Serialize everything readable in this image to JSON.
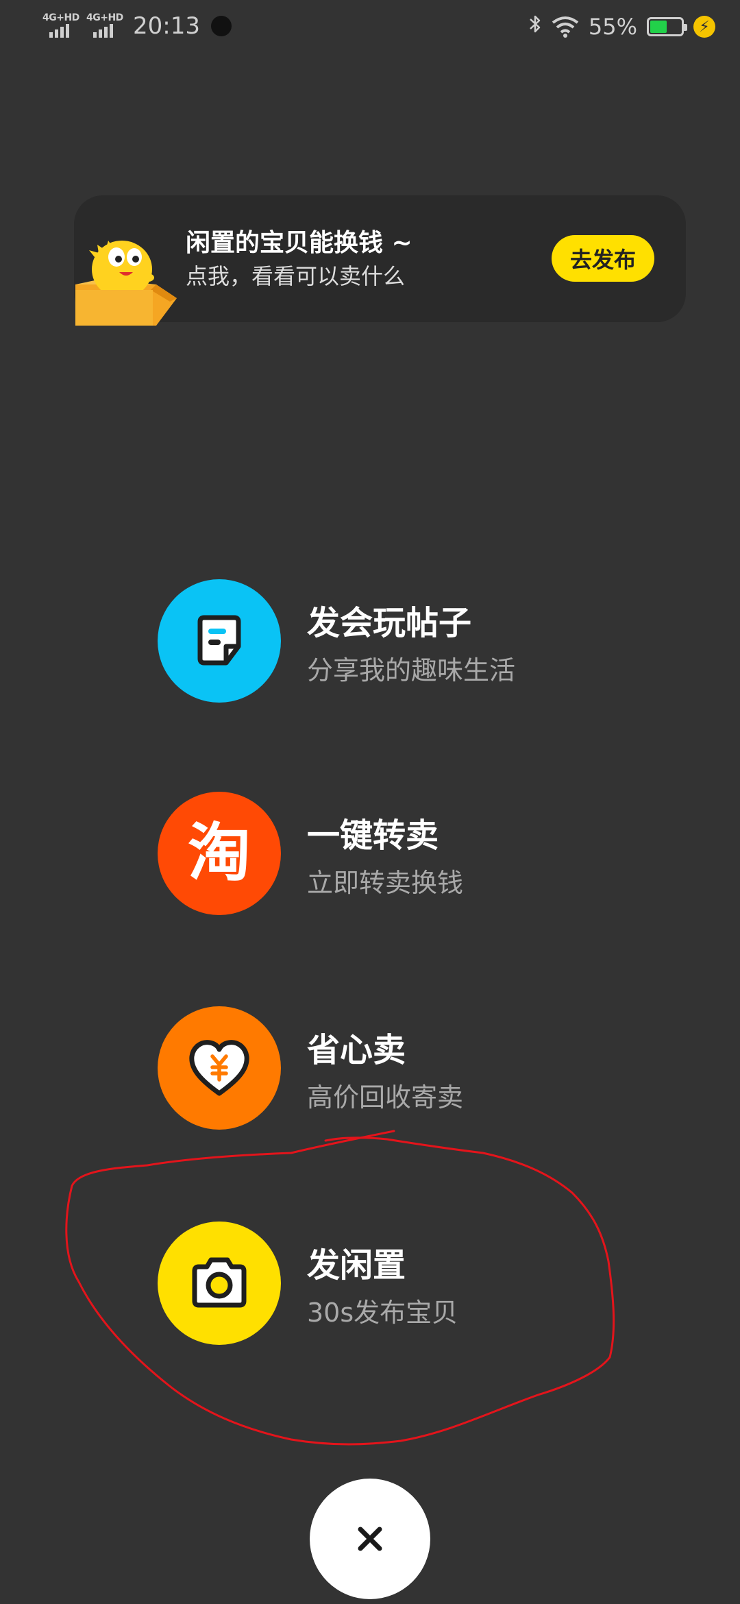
{
  "status_bar": {
    "network_1": "4G+HD",
    "network_2": "4G+HD",
    "time": "20:13",
    "battery_percent": "55%",
    "battery_level": 0.55
  },
  "promo": {
    "title": "闲置的宝贝能换钱 ~",
    "subtitle": "点我，看看可以卖什么",
    "button_label": "去发布"
  },
  "actions": [
    {
      "title": "发会玩帖子",
      "subtitle": "分享我的趣味生活",
      "icon": "post-icon",
      "color": "#0ac3f5"
    },
    {
      "title": "一键转卖",
      "subtitle": "立即转卖换钱",
      "icon": "taobao-icon",
      "glyph": "淘",
      "color": "#ff4a05"
    },
    {
      "title": "省心卖",
      "subtitle": "高价回收寄卖",
      "icon": "heart-yen-icon",
      "color": "#ff7a00"
    },
    {
      "title": "发闲置",
      "subtitle": "30s发布宝贝",
      "icon": "camera-icon",
      "color": "#ffe000"
    }
  ],
  "close": {
    "icon": "close-icon"
  },
  "colors": {
    "background": "#333333",
    "accent_yellow": "#ffe000",
    "annotation_red": "#e3141b"
  }
}
